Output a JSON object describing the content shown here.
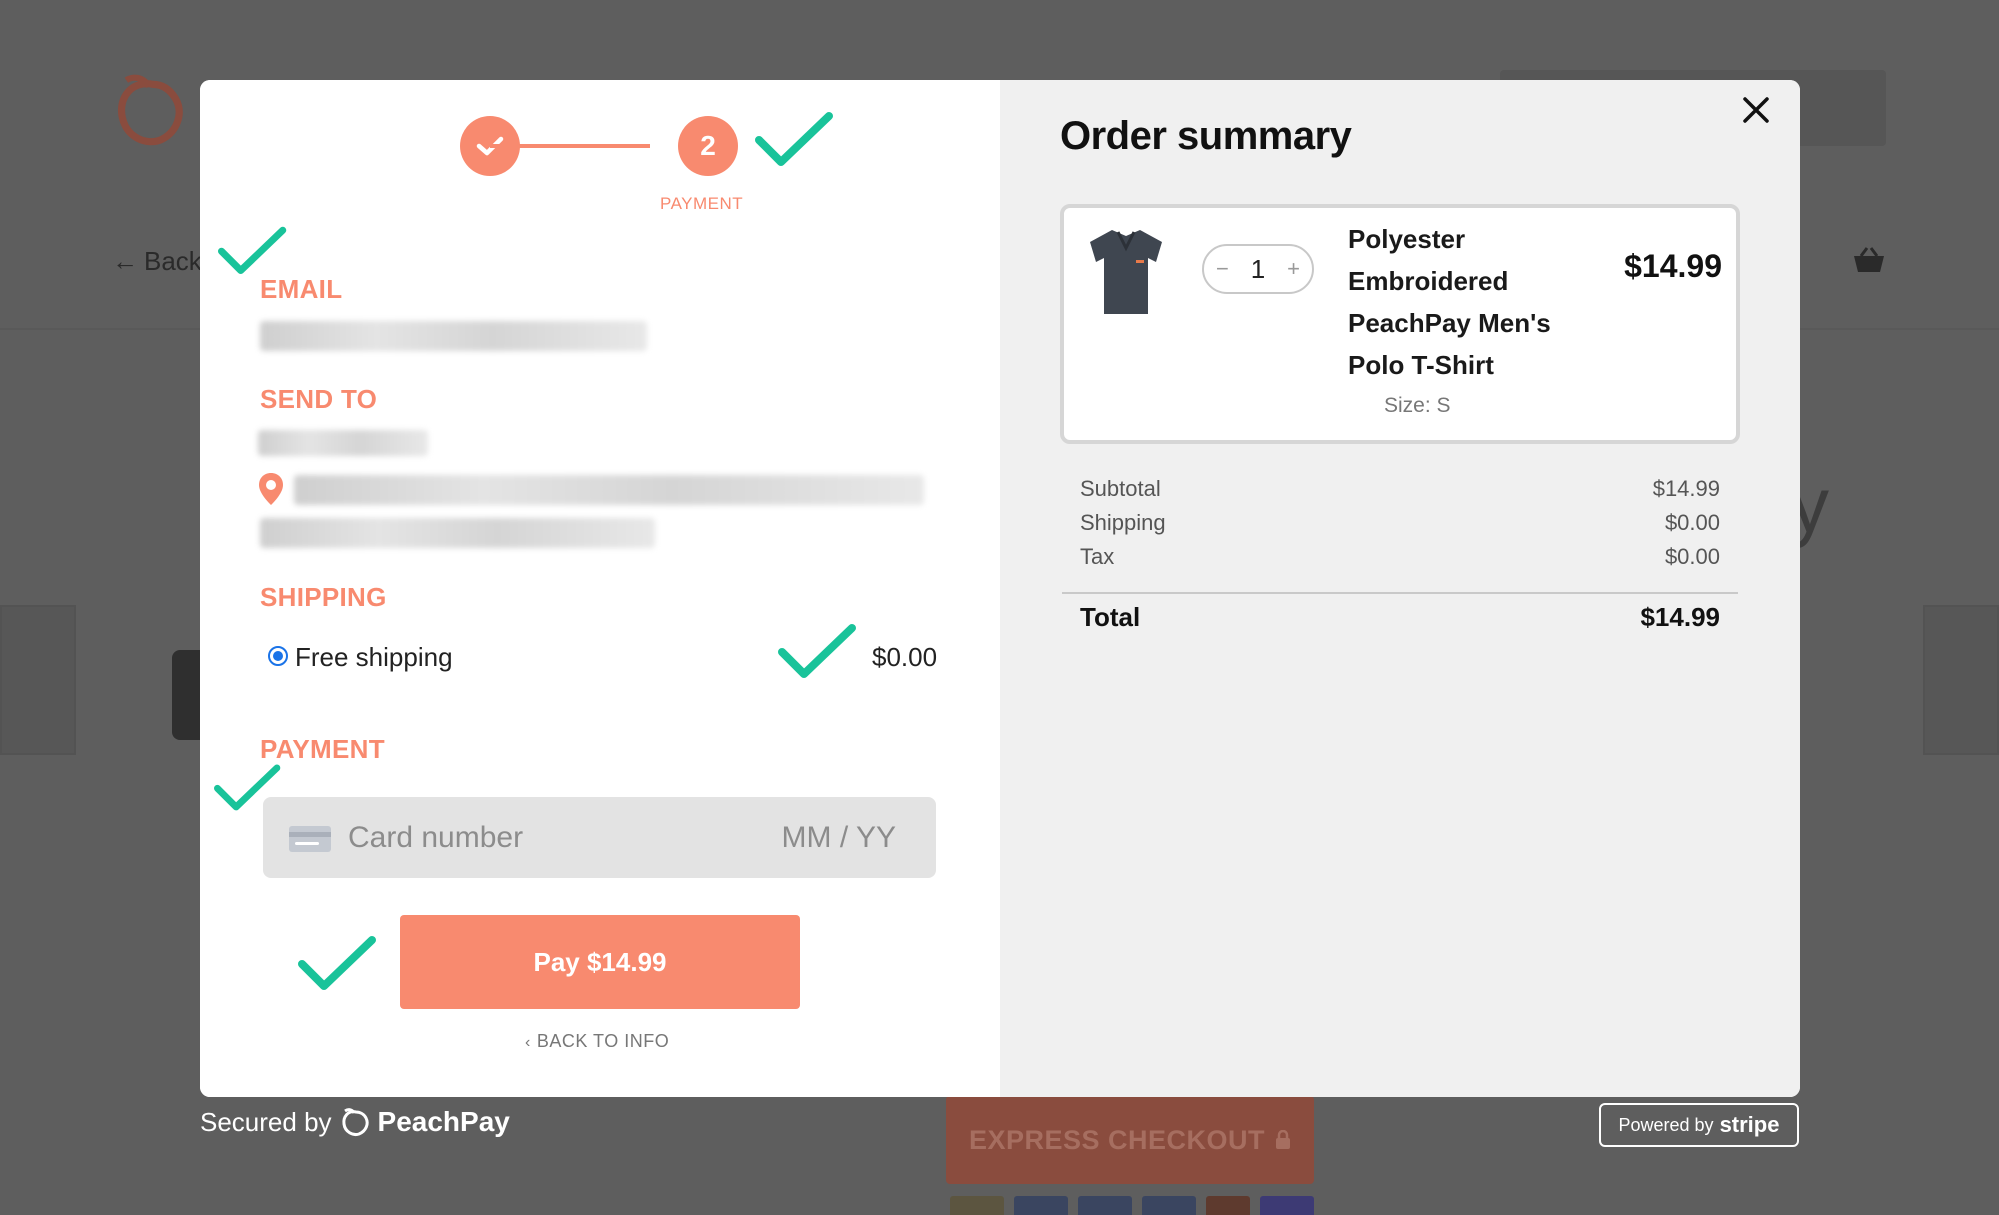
{
  "background": {
    "back_label": "Back",
    "express_checkout_label": "EXPRESS CHECKOUT"
  },
  "stepper": {
    "step2_number": "2",
    "step2_label": "PAYMENT"
  },
  "form": {
    "email_title": "EMAIL",
    "send_to_title": "SEND TO",
    "shipping_title": "SHIPPING",
    "shipping_option_label": "Free shipping",
    "shipping_option_price": "$0.00",
    "payment_title": "PAYMENT",
    "card_number_placeholder": "Card number",
    "expiry_placeholder": "MM / YY",
    "pay_button_label": "Pay $14.99",
    "back_link_label": "BACK TO INFO"
  },
  "summary": {
    "title": "Order summary",
    "product": {
      "name": "Polyester Embroidered PeachPay Men's Polo T-Shirt",
      "quantity": "1",
      "price": "$14.99",
      "size": "Size: S"
    },
    "lines": [
      {
        "label": "Subtotal",
        "value": "$14.99"
      },
      {
        "label": "Shipping",
        "value": "$0.00"
      },
      {
        "label": "Tax",
        "value": "$0.00"
      }
    ],
    "total_label": "Total",
    "total_value": "$14.99"
  },
  "footer": {
    "secured_by": "Secured by",
    "brand_name": "PeachPay",
    "powered_by": "Powered by",
    "stripe_word": "stripe"
  },
  "colors": {
    "accent": "#f88a6f",
    "check_mark": "#19c39a",
    "radio": "#1a73e8"
  }
}
